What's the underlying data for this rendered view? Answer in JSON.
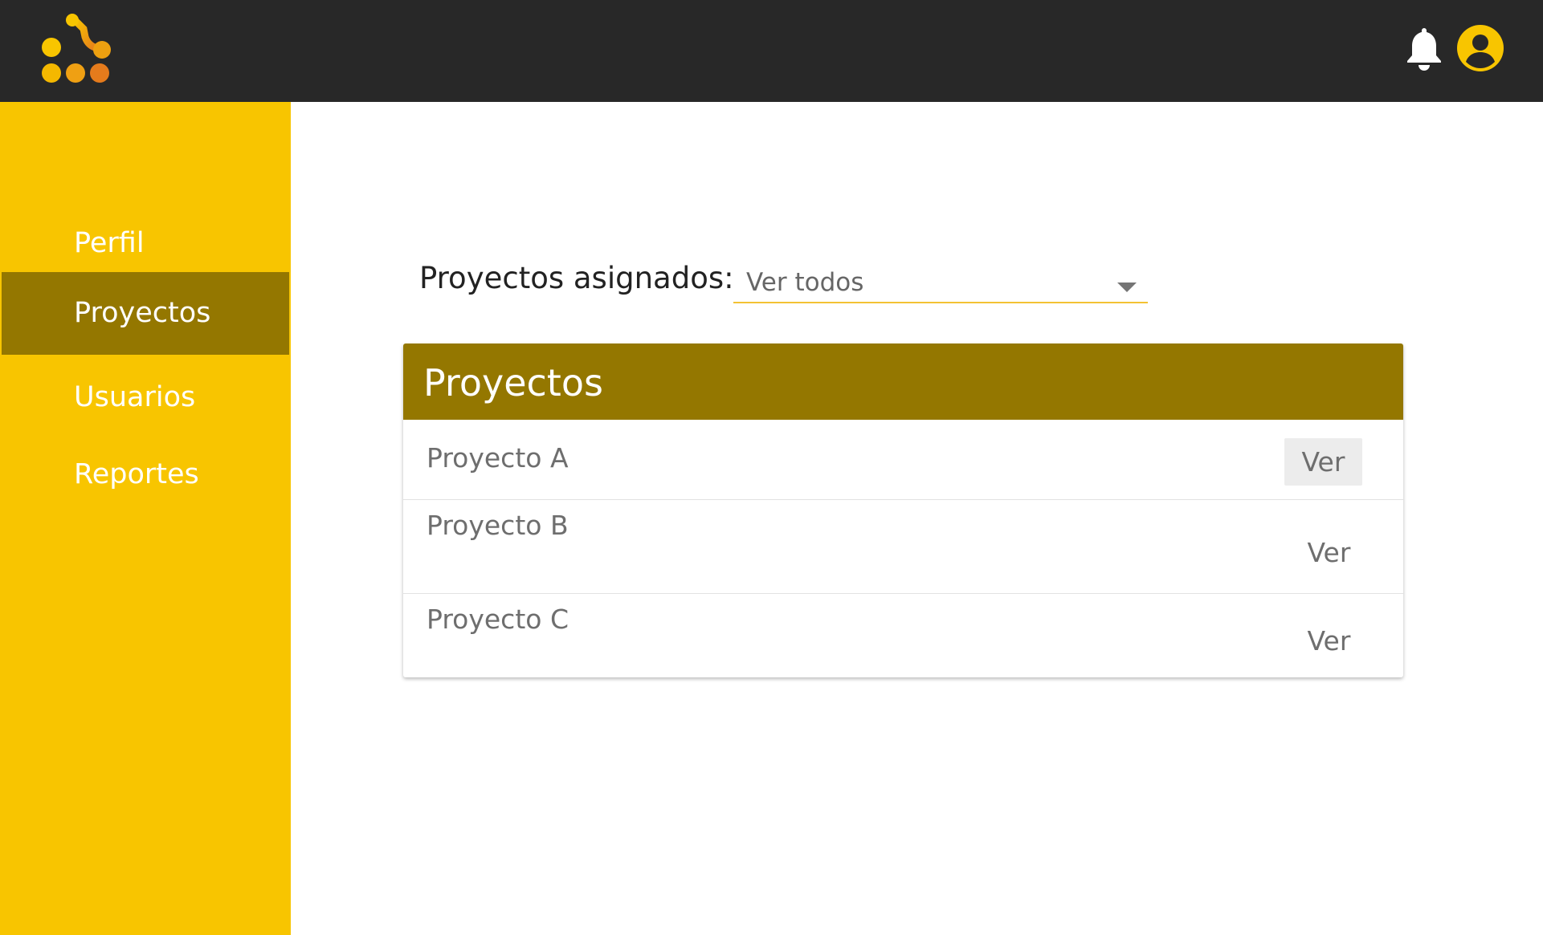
{
  "header": {
    "logo_icon": "app-logo-icon",
    "notification_icon": "bell-icon",
    "account_icon": "user-account-icon",
    "colors": {
      "background": "#282828",
      "accent": "#f8c500"
    }
  },
  "sidebar": {
    "items": [
      {
        "label": "Perfil",
        "active": false
      },
      {
        "label": "Proyectos",
        "active": true
      },
      {
        "label": "Usuarios",
        "active": false
      },
      {
        "label": "Reportes",
        "active": false
      }
    ],
    "colors": {
      "background": "#f8c500",
      "active_background": "#947700"
    }
  },
  "main": {
    "filter": {
      "label": "Proyectos asignados:",
      "selected": "Ver todos"
    },
    "projects_card": {
      "title": "Proyectos",
      "rows": [
        {
          "name": "Proyecto A",
          "action": "Ver"
        },
        {
          "name": "Proyecto B",
          "action": "Ver"
        },
        {
          "name": "Proyecto C",
          "action": "Ver"
        }
      ]
    }
  }
}
